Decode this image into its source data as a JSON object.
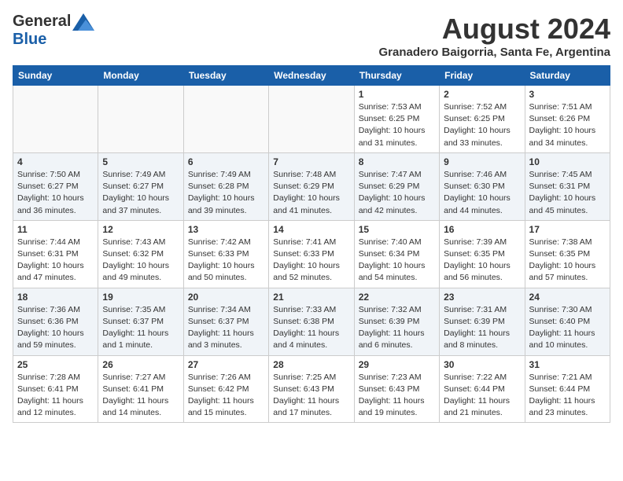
{
  "header": {
    "logo_general": "General",
    "logo_blue": "Blue",
    "month_year": "August 2024",
    "location": "Granadero Baigorria, Santa Fe, Argentina"
  },
  "weekdays": [
    "Sunday",
    "Monday",
    "Tuesday",
    "Wednesday",
    "Thursday",
    "Friday",
    "Saturday"
  ],
  "weeks": [
    [
      {
        "day": "",
        "info": ""
      },
      {
        "day": "",
        "info": ""
      },
      {
        "day": "",
        "info": ""
      },
      {
        "day": "",
        "info": ""
      },
      {
        "day": "1",
        "info": "Sunrise: 7:53 AM\nSunset: 6:25 PM\nDaylight: 10 hours and 31 minutes."
      },
      {
        "day": "2",
        "info": "Sunrise: 7:52 AM\nSunset: 6:25 PM\nDaylight: 10 hours and 33 minutes."
      },
      {
        "day": "3",
        "info": "Sunrise: 7:51 AM\nSunset: 6:26 PM\nDaylight: 10 hours and 34 minutes."
      }
    ],
    [
      {
        "day": "4",
        "info": "Sunrise: 7:50 AM\nSunset: 6:27 PM\nDaylight: 10 hours and 36 minutes."
      },
      {
        "day": "5",
        "info": "Sunrise: 7:49 AM\nSunset: 6:27 PM\nDaylight: 10 hours and 37 minutes."
      },
      {
        "day": "6",
        "info": "Sunrise: 7:49 AM\nSunset: 6:28 PM\nDaylight: 10 hours and 39 minutes."
      },
      {
        "day": "7",
        "info": "Sunrise: 7:48 AM\nSunset: 6:29 PM\nDaylight: 10 hours and 41 minutes."
      },
      {
        "day": "8",
        "info": "Sunrise: 7:47 AM\nSunset: 6:29 PM\nDaylight: 10 hours and 42 minutes."
      },
      {
        "day": "9",
        "info": "Sunrise: 7:46 AM\nSunset: 6:30 PM\nDaylight: 10 hours and 44 minutes."
      },
      {
        "day": "10",
        "info": "Sunrise: 7:45 AM\nSunset: 6:31 PM\nDaylight: 10 hours and 45 minutes."
      }
    ],
    [
      {
        "day": "11",
        "info": "Sunrise: 7:44 AM\nSunset: 6:31 PM\nDaylight: 10 hours and 47 minutes."
      },
      {
        "day": "12",
        "info": "Sunrise: 7:43 AM\nSunset: 6:32 PM\nDaylight: 10 hours and 49 minutes."
      },
      {
        "day": "13",
        "info": "Sunrise: 7:42 AM\nSunset: 6:33 PM\nDaylight: 10 hours and 50 minutes."
      },
      {
        "day": "14",
        "info": "Sunrise: 7:41 AM\nSunset: 6:33 PM\nDaylight: 10 hours and 52 minutes."
      },
      {
        "day": "15",
        "info": "Sunrise: 7:40 AM\nSunset: 6:34 PM\nDaylight: 10 hours and 54 minutes."
      },
      {
        "day": "16",
        "info": "Sunrise: 7:39 AM\nSunset: 6:35 PM\nDaylight: 10 hours and 56 minutes."
      },
      {
        "day": "17",
        "info": "Sunrise: 7:38 AM\nSunset: 6:35 PM\nDaylight: 10 hours and 57 minutes."
      }
    ],
    [
      {
        "day": "18",
        "info": "Sunrise: 7:36 AM\nSunset: 6:36 PM\nDaylight: 10 hours and 59 minutes."
      },
      {
        "day": "19",
        "info": "Sunrise: 7:35 AM\nSunset: 6:37 PM\nDaylight: 11 hours and 1 minute."
      },
      {
        "day": "20",
        "info": "Sunrise: 7:34 AM\nSunset: 6:37 PM\nDaylight: 11 hours and 3 minutes."
      },
      {
        "day": "21",
        "info": "Sunrise: 7:33 AM\nSunset: 6:38 PM\nDaylight: 11 hours and 4 minutes."
      },
      {
        "day": "22",
        "info": "Sunrise: 7:32 AM\nSunset: 6:39 PM\nDaylight: 11 hours and 6 minutes."
      },
      {
        "day": "23",
        "info": "Sunrise: 7:31 AM\nSunset: 6:39 PM\nDaylight: 11 hours and 8 minutes."
      },
      {
        "day": "24",
        "info": "Sunrise: 7:30 AM\nSunset: 6:40 PM\nDaylight: 11 hours and 10 minutes."
      }
    ],
    [
      {
        "day": "25",
        "info": "Sunrise: 7:28 AM\nSunset: 6:41 PM\nDaylight: 11 hours and 12 minutes."
      },
      {
        "day": "26",
        "info": "Sunrise: 7:27 AM\nSunset: 6:41 PM\nDaylight: 11 hours and 14 minutes."
      },
      {
        "day": "27",
        "info": "Sunrise: 7:26 AM\nSunset: 6:42 PM\nDaylight: 11 hours and 15 minutes."
      },
      {
        "day": "28",
        "info": "Sunrise: 7:25 AM\nSunset: 6:43 PM\nDaylight: 11 hours and 17 minutes."
      },
      {
        "day": "29",
        "info": "Sunrise: 7:23 AM\nSunset: 6:43 PM\nDaylight: 11 hours and 19 minutes."
      },
      {
        "day": "30",
        "info": "Sunrise: 7:22 AM\nSunset: 6:44 PM\nDaylight: 11 hours and 21 minutes."
      },
      {
        "day": "31",
        "info": "Sunrise: 7:21 AM\nSunset: 6:44 PM\nDaylight: 11 hours and 23 minutes."
      }
    ]
  ]
}
